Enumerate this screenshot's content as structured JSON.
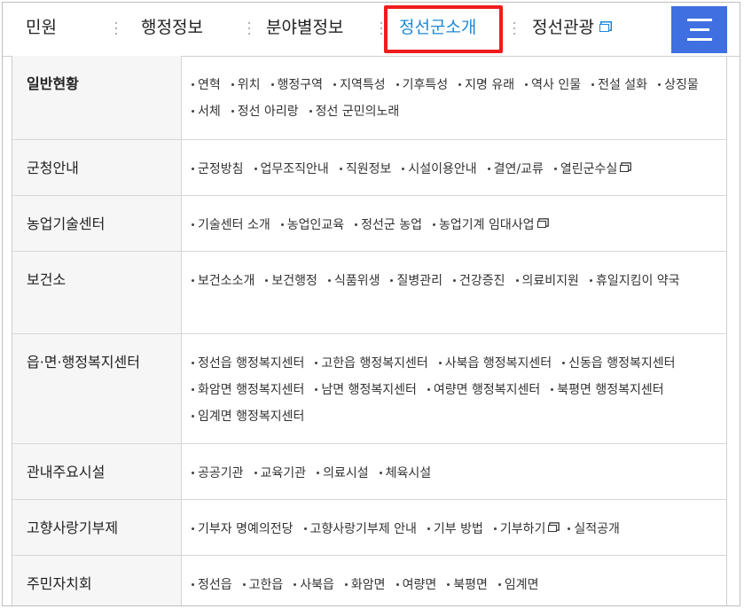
{
  "nav": {
    "tabs": [
      {
        "label": "민원",
        "external": false,
        "active": false
      },
      {
        "label": "행정정보",
        "external": false,
        "active": false
      },
      {
        "label": "분야별정보",
        "external": false,
        "active": false
      },
      {
        "label": "정선군소개",
        "external": false,
        "active": true
      },
      {
        "label": "정선관광",
        "external": true,
        "active": false
      }
    ],
    "menu_icon": "hamburger-menu-icon",
    "accent_color": "#1e88d8",
    "menu_button_color": "#3f6fe0",
    "highlight_color": "#ef1c1c"
  },
  "sections": [
    {
      "title": "일반현황",
      "items": [
        {
          "label": "연혁"
        },
        {
          "label": "위치"
        },
        {
          "label": "행정구역"
        },
        {
          "label": "지역특성"
        },
        {
          "label": "기후특성"
        },
        {
          "label": "지명 유래"
        },
        {
          "label": "역사 인물"
        },
        {
          "label": "전설 설화"
        },
        {
          "label": "상징물"
        },
        {
          "label": "서체"
        },
        {
          "label": "정선 아리랑"
        },
        {
          "label": "정선 군민의노래"
        }
      ]
    },
    {
      "title": "군청안내",
      "items": [
        {
          "label": "군정방침"
        },
        {
          "label": "업무조직안내"
        },
        {
          "label": "직원정보"
        },
        {
          "label": "시설이용안내"
        },
        {
          "label": "결연/교류"
        },
        {
          "label": "열린군수실",
          "external": true
        }
      ]
    },
    {
      "title": "농업기술센터",
      "items": [
        {
          "label": "기술센터 소개"
        },
        {
          "label": "농업인교육"
        },
        {
          "label": "정선군 농업"
        },
        {
          "label": "농업기계 임대사업",
          "external": true
        }
      ]
    },
    {
      "title": "보건소",
      "items": [
        {
          "label": "보건소소개"
        },
        {
          "label": "보건행정"
        },
        {
          "label": "식품위생"
        },
        {
          "label": "질병관리"
        },
        {
          "label": "건강증진"
        },
        {
          "label": "의료비지원"
        },
        {
          "label": "휴일지킴이 약국"
        }
      ]
    },
    {
      "title": "읍·면·행정복지센터",
      "items": [
        {
          "label": "정선읍 행정복지센터"
        },
        {
          "label": "고한읍 행정복지센터"
        },
        {
          "label": "사북읍 행정복지센터"
        },
        {
          "label": "신동읍 행정복지센터"
        },
        {
          "label": "화암면 행정복지센터"
        },
        {
          "label": "남면 행정복지센터"
        },
        {
          "label": "여량면 행정복지센터"
        },
        {
          "label": "북평면 행정복지센터"
        },
        {
          "label": "임계면 행정복지센터"
        }
      ]
    },
    {
      "title": "관내주요시설",
      "items": [
        {
          "label": "공공기관"
        },
        {
          "label": "교육기관"
        },
        {
          "label": "의료시설"
        },
        {
          "label": "체육시설"
        }
      ]
    },
    {
      "title": "고향사랑기부제",
      "items": [
        {
          "label": "기부자 명예의전당"
        },
        {
          "label": "고향사랑기부제 안내"
        },
        {
          "label": "기부 방법"
        },
        {
          "label": "기부하기",
          "external": true
        },
        {
          "label": "실적공개"
        }
      ]
    },
    {
      "title": "주민자치회",
      "items": [
        {
          "label": "정선읍"
        },
        {
          "label": "고한읍"
        },
        {
          "label": "사북읍"
        },
        {
          "label": "화암면"
        },
        {
          "label": "여량면"
        },
        {
          "label": "북평면"
        },
        {
          "label": "임계면"
        }
      ]
    }
  ]
}
